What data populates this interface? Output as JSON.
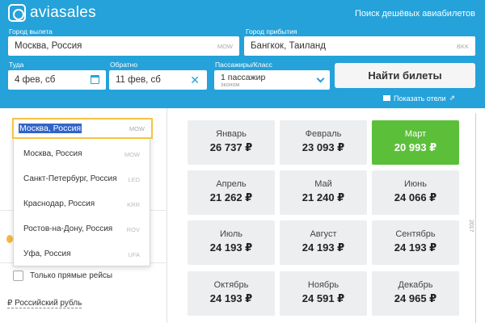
{
  "header": {
    "brand": "aviasales",
    "tagline": "Поиск дешёвых авиабилетов",
    "origin_label": "Город вылета",
    "origin_value": "Москва, Россия",
    "origin_code": "MOW",
    "destination_label": "Город прибытия",
    "destination_value": "Бангкок, Таиланд",
    "destination_code": "BKK",
    "depart_label": "Туда",
    "depart_value": "4 фев, сб",
    "return_label": "Обратно",
    "return_value": "11 фев, сб",
    "pax_label": "Пассажиры/Класс",
    "pax_value": "1 пассажир",
    "pax_class": "эконом",
    "search_button": "Найти билеты",
    "show_hotels": "Показать отели"
  },
  "dropdown": {
    "input_value": "Москва, Россия",
    "input_code": "MOW",
    "items": [
      {
        "city": "Москва, Россия",
        "code": "MOW"
      },
      {
        "city": "Санкт-Петербург, Россия",
        "code": "LED"
      },
      {
        "city": "Краснодар, Россия",
        "code": "KRR"
      },
      {
        "city": "Ростов-на-Дону, Россия",
        "code": "ROV"
      },
      {
        "city": "Уфа, Россия",
        "code": "UFA"
      }
    ]
  },
  "filters": {
    "direct_only": "Только прямые рейсы",
    "currency": "₽ Российский рубль"
  },
  "months": [
    {
      "name": "Январь",
      "price": "26 737 ₽"
    },
    {
      "name": "Февраль",
      "price": "23 093 ₽"
    },
    {
      "name": "Март",
      "price": "20 993 ₽"
    },
    {
      "name": "Апрель",
      "price": "21 262 ₽"
    },
    {
      "name": "Май",
      "price": "21 240 ₽"
    },
    {
      "name": "Июнь",
      "price": "24 066 ₽"
    },
    {
      "name": "Июль",
      "price": "24 193 ₽"
    },
    {
      "name": "Август",
      "price": "24 193 ₽"
    },
    {
      "name": "Сентябрь",
      "price": "24 193 ₽"
    },
    {
      "name": "Октябрь",
      "price": "24 193 ₽"
    },
    {
      "name": "Ноябрь",
      "price": "24 591 ₽"
    },
    {
      "name": "Декабрь",
      "price": "24 965 ₽"
    }
  ],
  "year": "2017",
  "colors": {
    "header": "#24a2d9",
    "cheapest": "#5cbf3a",
    "focus": "#f6c444"
  }
}
